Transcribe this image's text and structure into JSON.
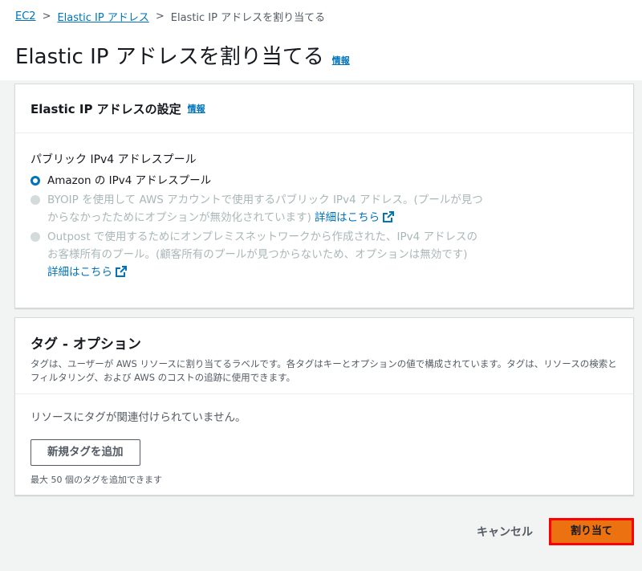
{
  "breadcrumb": {
    "items": [
      "EC2",
      "Elastic IP アドレス",
      "Elastic IP アドレスを割り当てる"
    ]
  },
  "page": {
    "title": "Elastic IP アドレスを割り当てる",
    "info": "情報"
  },
  "settings": {
    "title": "Elastic IP アドレスの設定",
    "info": "情報",
    "pool_label": "パブリック IPv4 アドレスプール",
    "options": [
      {
        "label": "Amazon の IPv4 アドレスプール",
        "selected": true,
        "disabled": false
      },
      {
        "label": "BYOIP を使用して AWS アカウントで使用するパブリック IPv4 アドレス。(プールが見つからなかったためにオプションが無効化されています)",
        "link": "詳細はこちら",
        "selected": false,
        "disabled": true
      },
      {
        "label": "Outpost で使用するためにオンプレミスネットワークから作成された、IPv4 アドレスのお客様所有のプール。(顧客所有のプールが見つからないため、オプションは無効です)",
        "link": "詳細はこちら",
        "selected": false,
        "disabled": true
      }
    ]
  },
  "tags": {
    "title": "タグ - オプション",
    "description": "タグは、ユーザーが AWS リソースに割り当てるラベルです。各タグはキーとオプションの値で構成されています。タグは、リソースの検索とフィルタリング、および AWS のコストの追跡に使用できます。",
    "empty_text": "リソースにタグが関連付けられていません。",
    "add_button": "新規タグを追加",
    "limit_text": "最大 50 個のタグを追加できます"
  },
  "actions": {
    "cancel": "キャンセル",
    "submit": "割り当て"
  },
  "colors": {
    "link": "#0073bb",
    "primary_button": "#ec7211",
    "highlight": "#ff0000"
  }
}
